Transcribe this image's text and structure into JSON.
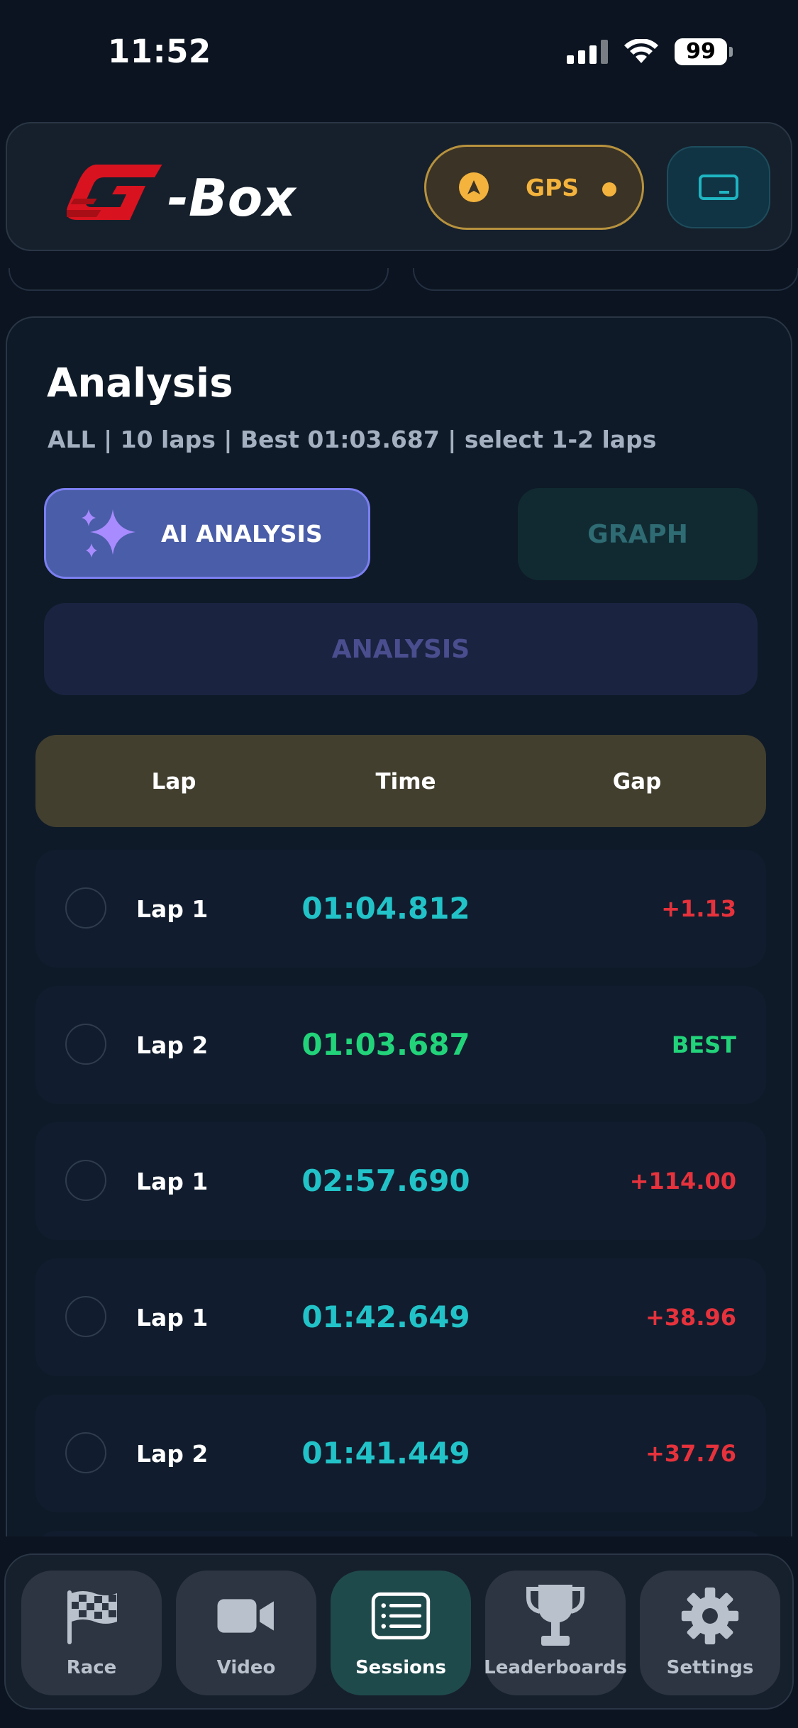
{
  "status_bar": {
    "time": "11:52",
    "battery": "99"
  },
  "header": {
    "logo_text": "G-Box",
    "gps_label": "GPS",
    "colors": {
      "gps": "#f3b33d",
      "device": "#1fb5c2"
    }
  },
  "analysis": {
    "title": "Analysis",
    "subtitle": "ALL | 10 laps | Best 01:03.687 | select 1-2 laps",
    "ai_button": "AI ANALYSIS",
    "graph_button": "GRAPH",
    "analysis_button": "ANALYSIS",
    "columns": {
      "lap": "Lap",
      "time": "Time",
      "gap": "Gap"
    },
    "rows": [
      {
        "lap": "Lap 1",
        "time": "01:04.812",
        "gap": "+1.13"
      },
      {
        "lap": "Lap 2",
        "time": "01:03.687",
        "gap": "BEST"
      },
      {
        "lap": "Lap 1",
        "time": "02:57.690",
        "gap": "+114.00"
      },
      {
        "lap": "Lap 1",
        "time": "01:42.649",
        "gap": "+38.96"
      },
      {
        "lap": "Lap 2",
        "time": "01:41.449",
        "gap": "+37.76"
      }
    ],
    "colors": {
      "time": "#22c3c8",
      "best": "#22d37a",
      "gap": "#e6323c"
    }
  },
  "nav": {
    "items": [
      {
        "label": "Race",
        "icon": "checkered-flag-icon"
      },
      {
        "label": "Video",
        "icon": "video-camera-icon"
      },
      {
        "label": "Sessions",
        "icon": "list-icon",
        "active": true
      },
      {
        "label": "Leaderboards",
        "icon": "trophy-icon"
      },
      {
        "label": "Settings",
        "icon": "gear-icon"
      }
    ]
  }
}
